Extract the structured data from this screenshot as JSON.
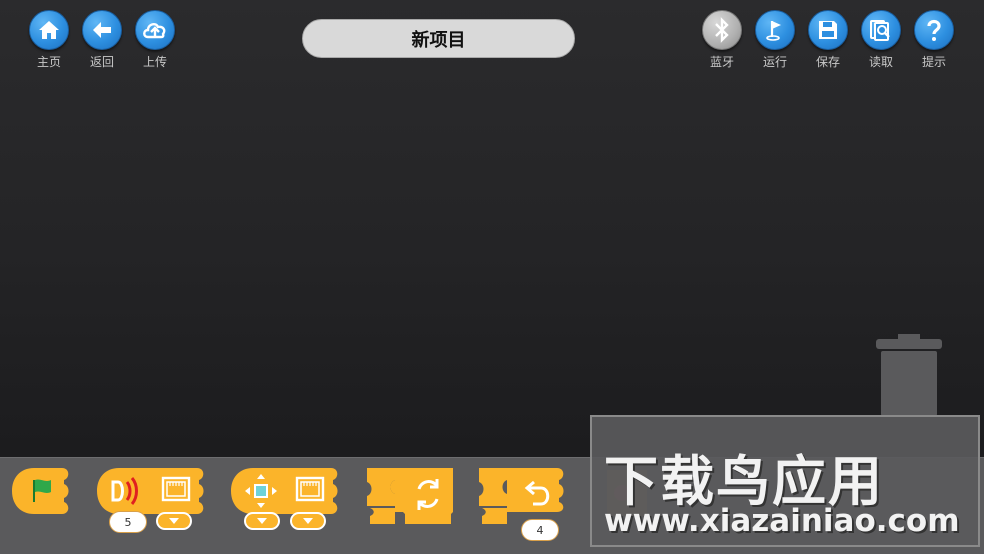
{
  "toolbar_left": [
    {
      "label": "主页",
      "icon": "home-icon"
    },
    {
      "label": "返回",
      "icon": "back-arrow-icon"
    },
    {
      "label": "上传",
      "icon": "cloud-upload-icon"
    }
  ],
  "project_title": "新项目",
  "toolbar_right": [
    {
      "label": "蓝牙",
      "icon": "bluetooth-icon"
    },
    {
      "label": "运行",
      "icon": "run-flag-icon"
    },
    {
      "label": "保存",
      "icon": "save-disk-icon"
    },
    {
      "label": "读取",
      "icon": "read-search-icon"
    },
    {
      "label": "提示",
      "icon": "help-question-icon"
    }
  ],
  "palette": {
    "sound_block_value": "5",
    "undo_loop_count": "4"
  },
  "watermark": {
    "chinese": "下载鸟应用",
    "url": "www.xiazainiao.com"
  },
  "colors": {
    "accent_blue": "#2d8fe0",
    "block_orange": "#fbb42a",
    "flag_green": "#2fa84a",
    "sound_red": "#e02020"
  }
}
